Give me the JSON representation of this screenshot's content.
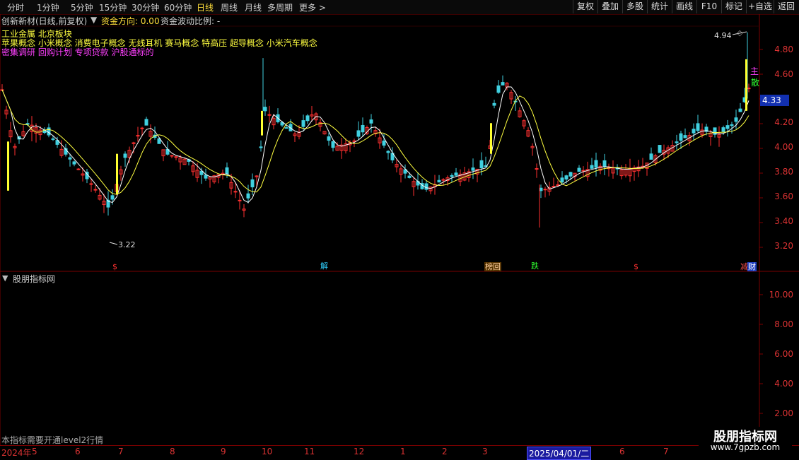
{
  "periods": [
    "分时",
    "1分钟",
    "5分钟",
    "15分钟",
    "30分钟",
    "60分钟",
    "日线",
    "周线",
    "月线",
    "多周期",
    "更多 >"
  ],
  "active_period": "日线",
  "right_buttons": [
    "复权",
    "叠加",
    "多股",
    "统计",
    "画线",
    "F10",
    "标记",
    "+自选",
    "返回"
  ],
  "header": {
    "title": "创新新材(日线,前复权)",
    "indicator_label": "资金方向: 0.00",
    "ratio_label": "资金波动比例: -"
  },
  "sectors": {
    "line1": "工业金属 北京板块",
    "line2": "苹果概念 小米概念 消费电子概念 无线耳机 赛马概念 特高压 超导概念 小米汽车概念",
    "line3": "密集调研 回购计划 专项贷款 沪股通标的"
  },
  "price_axis": [
    "4.80",
    "4.60",
    "4.40",
    "4.20",
    "4.00",
    "3.80",
    "3.60",
    "3.40",
    "3.20"
  ],
  "current_price": "4.33",
  "high_label": "4.94",
  "low_label": "3.22",
  "side_tags": [
    "主",
    "散"
  ],
  "signals": [
    {
      "text": "$",
      "color": "#ff3030"
    },
    {
      "text": "解",
      "color": "#30d0ff"
    },
    {
      "text": "榜回",
      "color": "#ffd0a0",
      "bg": "#553300"
    },
    {
      "text": "跌",
      "color": "#30ff30"
    },
    {
      "text": "$",
      "color": "#ff3030"
    },
    {
      "text": "减",
      "color": "#ff5050"
    },
    {
      "text": "财",
      "color": "#ffffff",
      "bg": "#2040c0"
    }
  ],
  "sub_panel": {
    "title": "股朋指标网",
    "axis": [
      "10.00",
      "8.00",
      "6.00",
      "4.00",
      "2.00"
    ]
  },
  "bottom_note": "本指标需要开通level2行情",
  "x_axis": [
    "2024年",
    "5",
    "6",
    "7",
    "8",
    "9",
    "10",
    "11",
    "12",
    "1",
    "2",
    "3",
    "5",
    "6",
    "7"
  ],
  "date_box": "2025/04/01/二",
  "watermark": {
    "title": "股朋指标网",
    "url": "www.7gpzb.com"
  },
  "colors": {
    "up": "#ff3030",
    "down": "#40d0e0",
    "ma_white": "#ffffff",
    "ma_yellow": "#ffff40",
    "accent": "#ffde3a",
    "red_frame": "#7a0000"
  }
}
